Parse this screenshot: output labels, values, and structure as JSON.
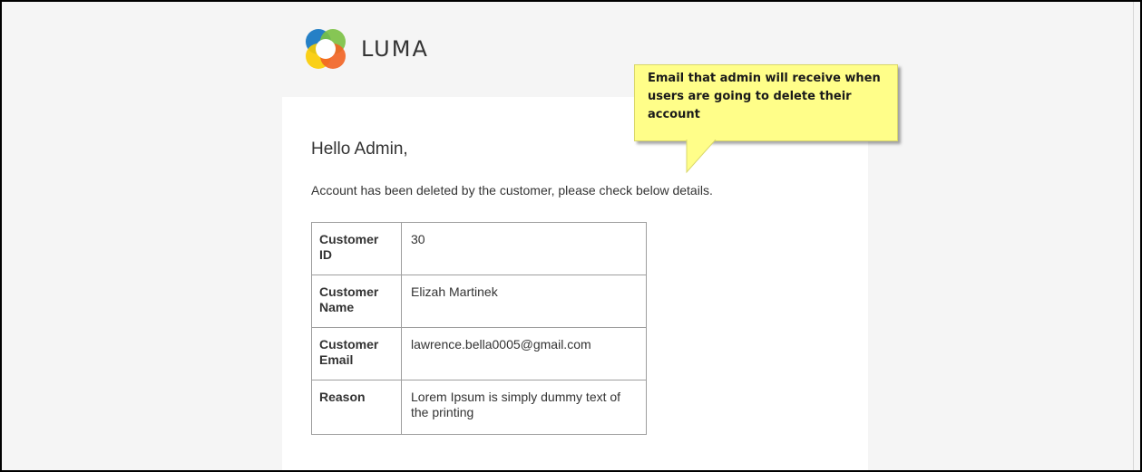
{
  "brand": {
    "logo_text": "LUMA",
    "logo_colors": [
      "#1979c3",
      "#f26322",
      "#fbcc00",
      "#7ac143"
    ]
  },
  "email": {
    "greeting": "Hello Admin,",
    "intro": "Account has been deleted by the customer, please check below details.",
    "details": [
      {
        "label": "Customer ID",
        "value": "30"
      },
      {
        "label": "Customer Name",
        "value": "Elizah Martinek"
      },
      {
        "label": "Customer Email",
        "value": "lawrence.bella0005@gmail.com"
      },
      {
        "label": "Reason",
        "value": "Lorem Ipsum is simply dummy text of the printing"
      }
    ]
  },
  "callout": {
    "text": "Email that admin will receive when users are going to delete their account",
    "color": "#fffe89"
  }
}
